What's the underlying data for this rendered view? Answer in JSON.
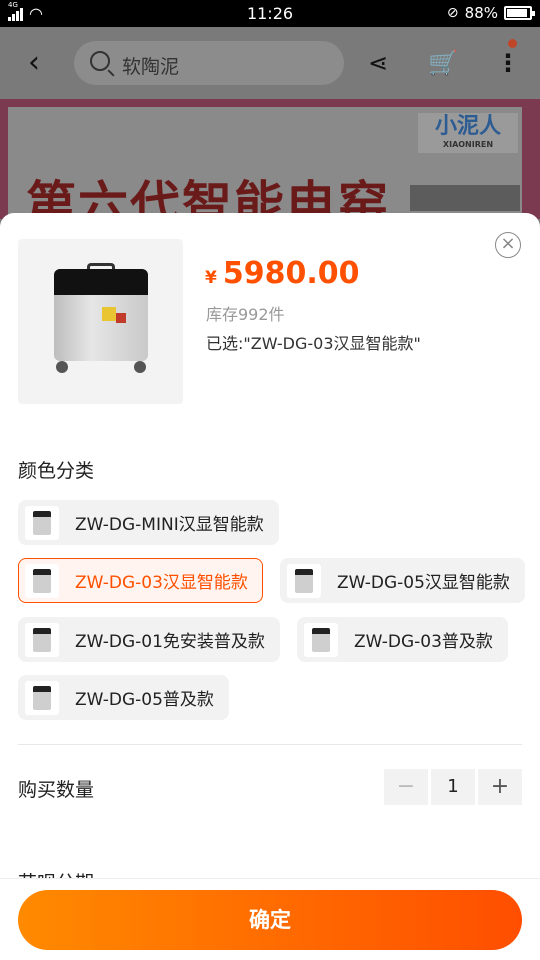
{
  "status_bar": {
    "network": "4G",
    "time": "11:26",
    "battery": "88%"
  },
  "header": {
    "search_placeholder": "软陶泥"
  },
  "banner": {
    "logo_text": "小泥人",
    "logo_sub": "XIAONIREN",
    "headline": "第六代智能电窑"
  },
  "sheet": {
    "price_currency": "¥",
    "price": "5980.00",
    "stock": "库存992件",
    "selected": "已选:\"ZW-DG-03汉显智能款\"",
    "color_section_title": "颜色分类",
    "options": [
      {
        "label": "ZW-DG-MINI汉显智能款",
        "selected": false
      },
      {
        "label": "ZW-DG-03汉显智能款",
        "selected": true
      },
      {
        "label": "ZW-DG-05汉显智能款",
        "selected": false
      },
      {
        "label": "ZW-DG-01免安装普及款",
        "selected": false
      },
      {
        "label": "ZW-DG-03普及款",
        "selected": false
      },
      {
        "label": "ZW-DG-05普及款",
        "selected": false
      }
    ],
    "quantity_title": "购买数量",
    "quantity": "1",
    "next_section_peek": "花呗分期",
    "confirm_label": "确定"
  },
  "colors": {
    "accent": "#ff5000",
    "button_gradient_start": "#ff8a00",
    "button_gradient_end": "#ff4e00"
  }
}
